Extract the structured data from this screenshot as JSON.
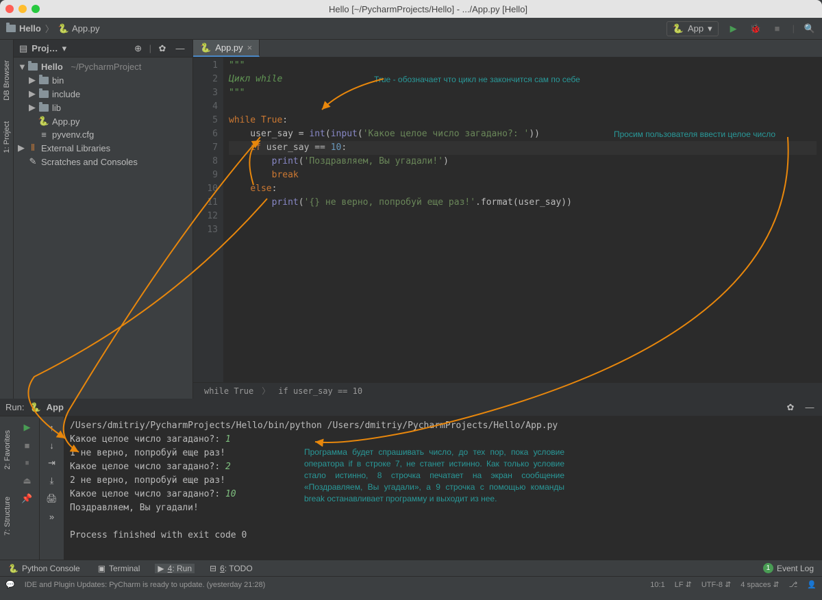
{
  "window": {
    "title": "Hello [~/PycharmProjects/Hello] - .../App.py [Hello]"
  },
  "breadcrumb": {
    "project": "Hello",
    "file": "App.py"
  },
  "runconfig": {
    "name": "App"
  },
  "project_panel": {
    "title": "Proj…",
    "root": "Hello",
    "root_path": "~/PycharmProject",
    "items": [
      {
        "label": "bin",
        "type": "folder"
      },
      {
        "label": "include",
        "type": "folder"
      },
      {
        "label": "lib",
        "type": "folder"
      },
      {
        "label": "App.py",
        "type": "python"
      },
      {
        "label": "pyvenv.cfg",
        "type": "file"
      }
    ],
    "external": "External Libraries",
    "scratches": "Scratches and Consoles"
  },
  "left_rail": {
    "db": "DB Browser",
    "project": "1: Project"
  },
  "editor": {
    "tab": "App.py",
    "lines": [
      "\"\"\"",
      "Цикл while",
      "\"\"\"",
      "",
      "while True:",
      "    user_say = int(input('Какое целое число загадано?: '))",
      "    if user_say == 10:",
      "        print('Поздравляем, Вы угадали!')",
      "        break",
      "    else:",
      "        print('{} не верно, попробуй еще раз!'.format(user_say))",
      "",
      ""
    ],
    "line_count": 13,
    "highlighted_line": 7
  },
  "annotations": {
    "top": "True - обозначает что цикл не закончится сам по себе",
    "right": "Просим пользователя ввести целое число",
    "bottom": "Программа будет спрашивать число, до тех пор, пока условие оператора if в строке 7, не станет истинно. Как только условие стало истинно, 8 строчка печатает на экран сообщение «Поздравляем, Вы угадали», а 9 строчка с помощью команды break останавливает программу и выходит из нее."
  },
  "code_breadcrumb": {
    "a": "while True",
    "b": "if user_say == 10"
  },
  "run_panel": {
    "title": "Run:",
    "config": "App",
    "console": {
      "cmd": "/Users/dmitriy/PycharmProjects/Hello/bin/python /Users/dmitriy/PycharmProjects/Hello/App.py",
      "prompt": "Какое целое число загадано?: ",
      "wrong": " не верно, попробуй еще раз!",
      "success": "Поздравляем, Вы угадали!",
      "exit": "Process finished with exit code 0",
      "inputs": [
        "1",
        "2",
        "10"
      ]
    }
  },
  "left_bottom_rail": {
    "fav": "2: Favorites",
    "struct": "7: Structure"
  },
  "bottom_tabs": {
    "console": "Python Console",
    "terminal": "Terminal",
    "run": "4: Run",
    "todo": "6: TODO",
    "eventlog": "Event Log",
    "event_count": "1"
  },
  "status": {
    "msg": "IDE and Plugin Updates: PyCharm is ready to update. (yesterday 21:28)",
    "pos": "10:1",
    "le": "LF",
    "enc": "UTF-8",
    "indent": "4 spaces"
  }
}
